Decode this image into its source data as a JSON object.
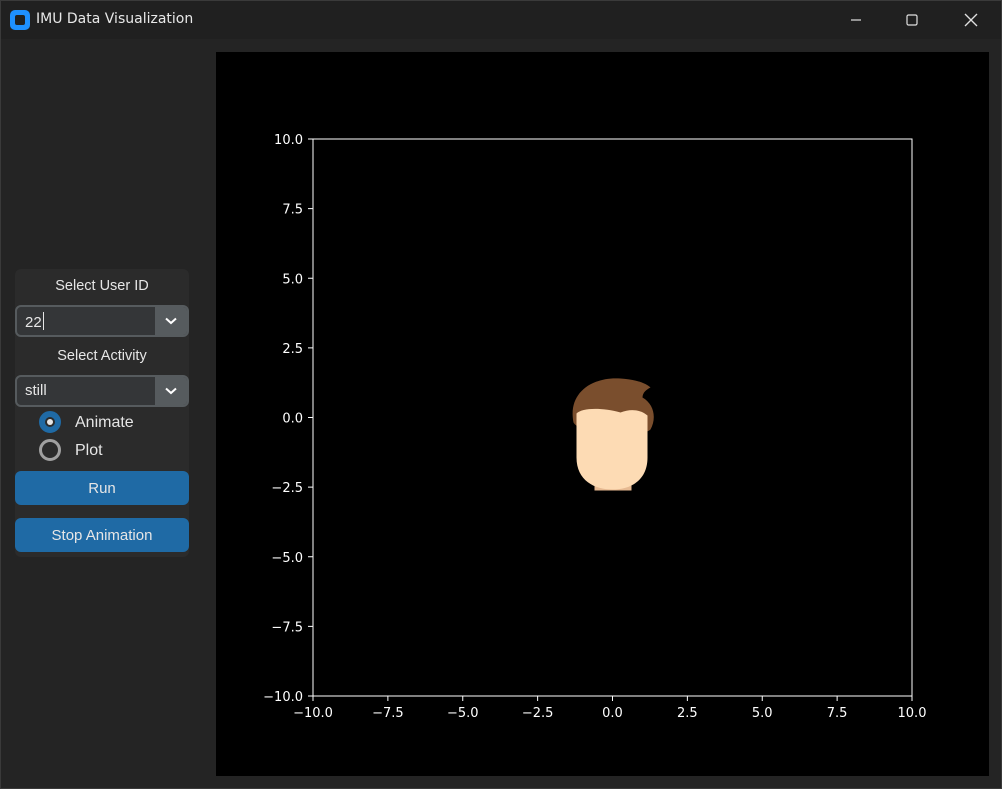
{
  "window": {
    "title": "IMU Data Visualization"
  },
  "sidebar": {
    "user_id_label": "Select User ID",
    "user_id_value": "22",
    "activity_label": "Select Activity",
    "activity_value": "still",
    "modes": [
      {
        "label": "Animate",
        "selected": true
      },
      {
        "label": "Plot",
        "selected": false
      }
    ],
    "run_label": "Run",
    "stop_label": "Stop Animation"
  },
  "colors": {
    "accent": "#1f6aa5",
    "panel": "#2b2b2b",
    "window_bg": "#242424",
    "plot_bg": "#000000",
    "hair": "#7a4e2d",
    "skin": "#fddbb4",
    "neck": "#e6b991"
  },
  "chart_data": {
    "type": "scatter",
    "title": "",
    "xlabel": "",
    "ylabel": "",
    "xlim": [
      -10,
      10
    ],
    "ylim": [
      -10,
      10
    ],
    "x_ticks": [
      "−10.0",
      "−7.5",
      "−5.0",
      "−2.5",
      "0.0",
      "2.5",
      "5.0",
      "7.5",
      "10.0"
    ],
    "y_ticks": [
      "10.0",
      "7.5",
      "5.0",
      "2.5",
      "0.0",
      "−2.5",
      "−5.0",
      "−7.5",
      "−10.0"
    ],
    "x_tick_values": [
      -10,
      -7.5,
      -5,
      -2.5,
      0,
      2.5,
      5,
      7.5,
      10
    ],
    "y_tick_values": [
      10,
      7.5,
      5,
      2.5,
      0,
      -2.5,
      -5,
      -7.5,
      -10
    ],
    "grid": false,
    "marker": "head-icon",
    "series": [
      {
        "x": [
          0
        ],
        "y": [
          0
        ]
      }
    ]
  }
}
